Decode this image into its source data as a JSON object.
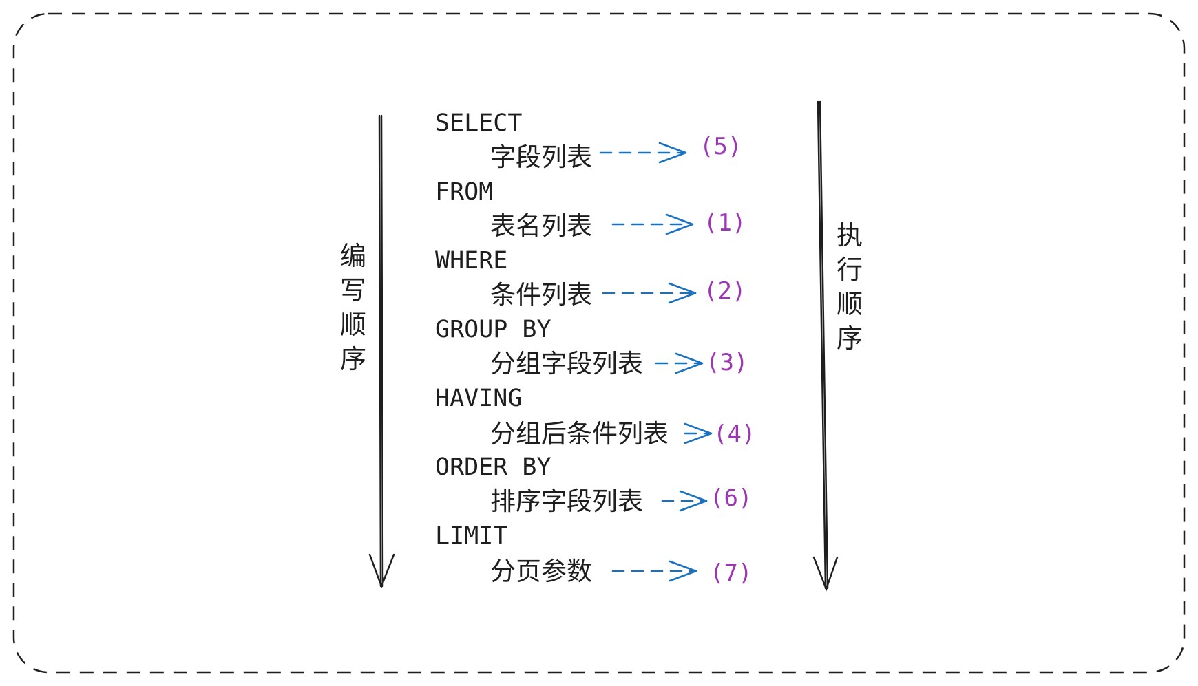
{
  "colors": {
    "text": "#1e1e1e",
    "arrow": "#1971c2",
    "number": "#9c36b5",
    "frame": "#1e1e1e"
  },
  "left_label": "编写顺序",
  "right_label": "执行顺序",
  "clauses": [
    {
      "keyword": "SELECT",
      "item": "字段列表",
      "order": "(5)"
    },
    {
      "keyword": "FROM",
      "item": "表名列表",
      "order": "(1)"
    },
    {
      "keyword": "WHERE",
      "item": "条件列表",
      "order": "(2)"
    },
    {
      "keyword": "GROUP BY",
      "item": "分组字段列表",
      "order": "(3)"
    },
    {
      "keyword": "HAVING",
      "item": "分组后条件列表",
      "order": "(4)"
    },
    {
      "keyword": "ORDER BY",
      "item": "排序字段列表",
      "order": "(6)"
    },
    {
      "keyword": "LIMIT",
      "item": "分页参数",
      "order": "(7)"
    }
  ]
}
